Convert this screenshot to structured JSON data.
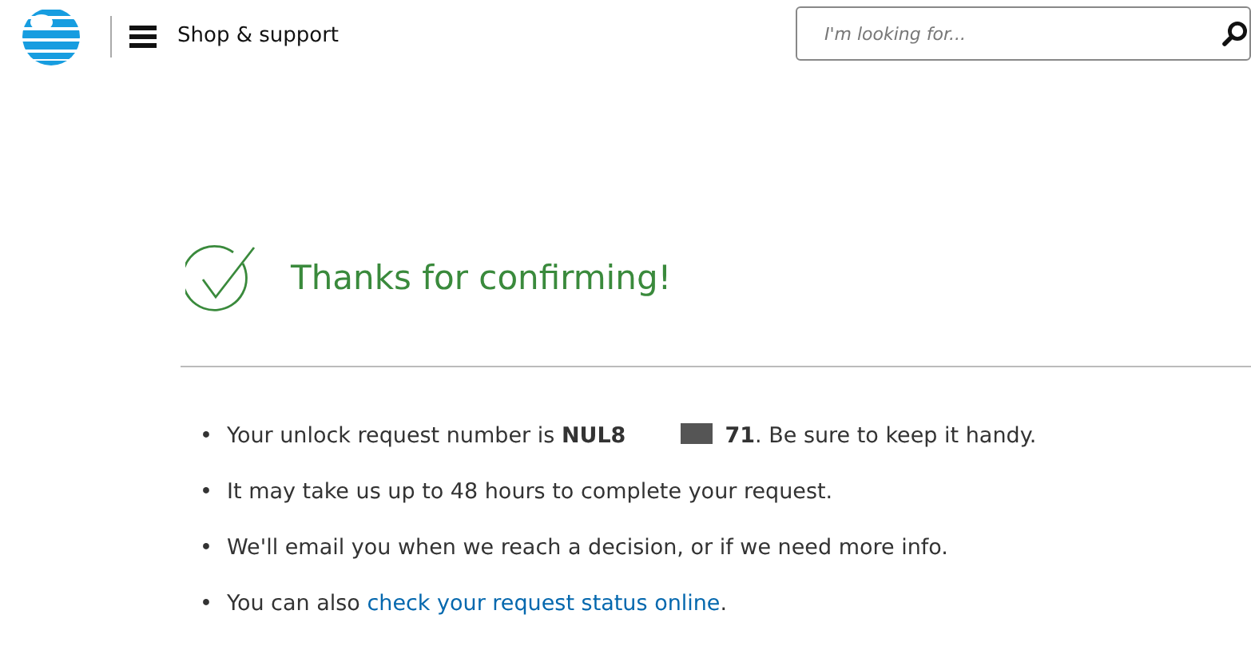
{
  "header": {
    "menu_label": "Shop & support",
    "search": {
      "placeholder": "I'm looking for..."
    }
  },
  "confirmation": {
    "title": "Thanks for confirming!"
  },
  "bullets": [
    {
      "kind": "redacted",
      "marker": "•",
      "before": "Your unlock request number is **NUL8**",
      "after": "**71**. Be sure to keep it handy."
    },
    {
      "kind": "text",
      "marker": "•",
      "text": "It may take us up to 48 hours to complete your request."
    },
    {
      "kind": "text",
      "marker": "•",
      "text": "We'll email you when we reach a decision, or if we need more info."
    },
    {
      "kind": "link",
      "marker": "•",
      "before": "You can also ",
      "link": "check your request status online",
      "after": "."
    }
  ]
}
